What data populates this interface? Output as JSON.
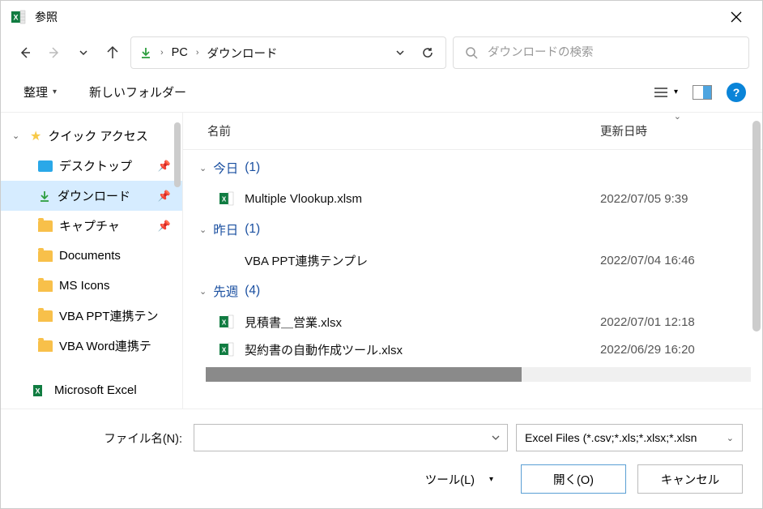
{
  "window": {
    "title": "参照"
  },
  "nav": {
    "back": "←",
    "forward": "→",
    "recent": "⌄",
    "up": "↑"
  },
  "address": {
    "crumb1": "PC",
    "crumb2": "ダウンロード"
  },
  "search": {
    "placeholder": "ダウンロードの検索"
  },
  "toolbar": {
    "organize": "整理",
    "new_folder": "新しいフォルダー",
    "help": "?"
  },
  "sidebar": {
    "quick_access": "クイック アクセス",
    "items": [
      {
        "label": "デスクトップ",
        "pinned": true,
        "icon": "desktop"
      },
      {
        "label": "ダウンロード",
        "pinned": true,
        "icon": "download",
        "selected": true
      },
      {
        "label": "キャプチャ",
        "pinned": true,
        "icon": "folder"
      },
      {
        "label": "Documents",
        "pinned": false,
        "icon": "folder"
      },
      {
        "label": "MS Icons",
        "pinned": false,
        "icon": "folder"
      },
      {
        "label": "VBA PPT連携テン",
        "pinned": false,
        "icon": "folder"
      },
      {
        "label": "VBA Word連携テ",
        "pinned": false,
        "icon": "folder"
      }
    ],
    "excel_item": "Microsoft Excel"
  },
  "columns": {
    "name": "名前",
    "date": "更新日時"
  },
  "groups": [
    {
      "label": "今日",
      "count": "(1)",
      "files": [
        {
          "name": "Multiple Vlookup.xlsm",
          "date": "2022/07/05 9:39",
          "type": "excel"
        }
      ]
    },
    {
      "label": "昨日",
      "count": "(1)",
      "files": [
        {
          "name": "VBA PPT連携テンプレ",
          "date": "2022/07/04 16:46",
          "type": "folder"
        }
      ]
    },
    {
      "label": "先週",
      "count": "(4)",
      "files": [
        {
          "name": "見積書＿営業.xlsx",
          "date": "2022/07/01 12:18",
          "type": "excel"
        },
        {
          "name": "契約書の自動作成ツール.xlsx",
          "date": "2022/06/29 16:20",
          "type": "excel"
        }
      ]
    }
  ],
  "footer": {
    "filename_label": "ファイル名(N):",
    "filter": "Excel Files (*.csv;*.xls;*.xlsx;*.xlsn",
    "tools": "ツール(L)",
    "open": "開く(O)",
    "cancel": "キャンセル"
  }
}
